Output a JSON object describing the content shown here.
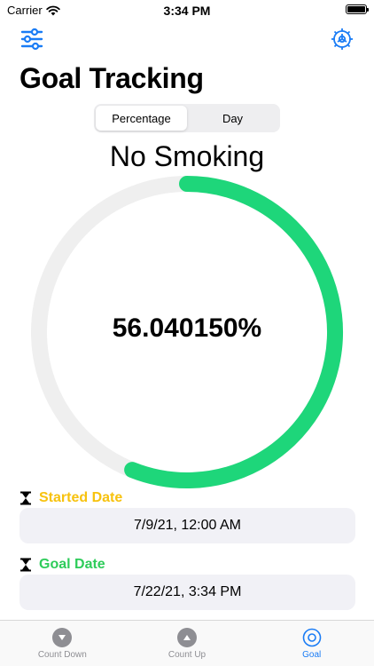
{
  "status_bar": {
    "carrier": "Carrier",
    "time": "3:34 PM"
  },
  "nav": {
    "left_icon": "sliders-icon",
    "right_icon": "settings-icon"
  },
  "page": {
    "title": "Goal Tracking"
  },
  "segmented_control": {
    "options": [
      "Percentage",
      "Day"
    ],
    "selected": "Percentage"
  },
  "goal": {
    "name": "No Smoking",
    "progress_text": "56.040150%",
    "progress_fraction": 0.5604015
  },
  "started": {
    "label": "Started Date",
    "value": "7/9/21, 12:00 AM"
  },
  "goal_date": {
    "label": "Goal Date",
    "value": "7/22/21, 3:34 PM"
  },
  "tab_bar": {
    "tabs": [
      {
        "label": "Count Down",
        "icon": "chevron-down-circle-icon"
      },
      {
        "label": "Count Up",
        "icon": "chevron-up-circle-icon"
      },
      {
        "label": "Goal",
        "icon": "target-icon"
      }
    ],
    "active_index": 2
  },
  "colors": {
    "accent_blue": "#1a7cf5",
    "progress_green": "#1ed67a",
    "track_gray": "#efefef",
    "started_yellow": "#f7c20e",
    "goal_green": "#2ecc5a",
    "inactive_gray": "#8e8e93"
  }
}
